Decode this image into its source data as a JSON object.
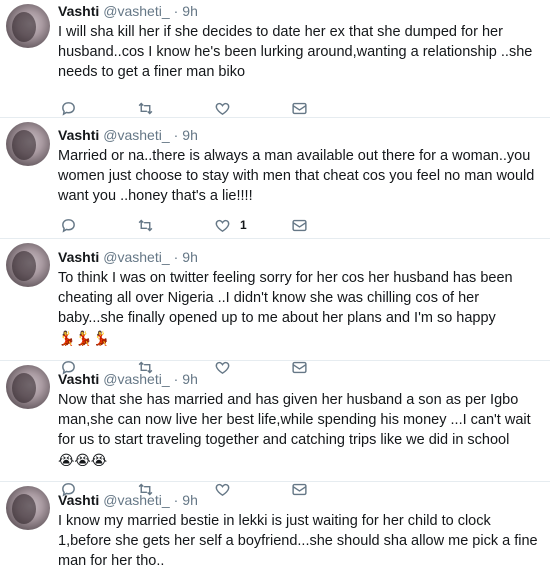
{
  "tweets": [
    {
      "name": "Vashti",
      "handle": "@vasheti_",
      "sep": "·",
      "time": "9h",
      "text": "I will sha kill her if she decides to date her ex that she dumped for her husband..cos I know he's been lurking around,wanting a relationship ..she needs to get a finer man biko",
      "emoji": "",
      "likes": ""
    },
    {
      "name": "Vashti",
      "handle": "@vasheti_",
      "sep": "·",
      "time": "9h",
      "text": "Married or na..there is always a man available out there for a woman..you women just choose to stay with men that cheat cos you feel no man would want you ..honey that's a lie!!!!",
      "emoji": "",
      "likes": "1"
    },
    {
      "name": "Vashti",
      "handle": "@vasheti_",
      "sep": "·",
      "time": "9h",
      "text": "To think I was on twitter feeling sorry for her cos her husband has been cheating all over Nigeria ..I didn't know she was chilling cos of her baby...she finally opened up to me about her plans and I'm so happy ",
      "emoji": "💃💃💃",
      "likes": ""
    },
    {
      "name": "Vashti",
      "handle": "@vasheti_",
      "sep": "·",
      "time": "9h",
      "text": "Now that she has married and has given her husband a son as per Igbo man,she can now live her best life,while spending his money ...I can't wait for us to start traveling together and catching trips like we did in school ",
      "emoji": "😭😭😭",
      "likes": ""
    },
    {
      "name": "Vashti",
      "handle": "@vasheti_",
      "sep": "·",
      "time": "9h",
      "text": "I know my married bestie in lekki is just waiting for her child to clock 1,before she gets her self a boyfriend...she should sha allow me pick a fine man for her tho..",
      "emoji": "",
      "likes": ""
    }
  ]
}
